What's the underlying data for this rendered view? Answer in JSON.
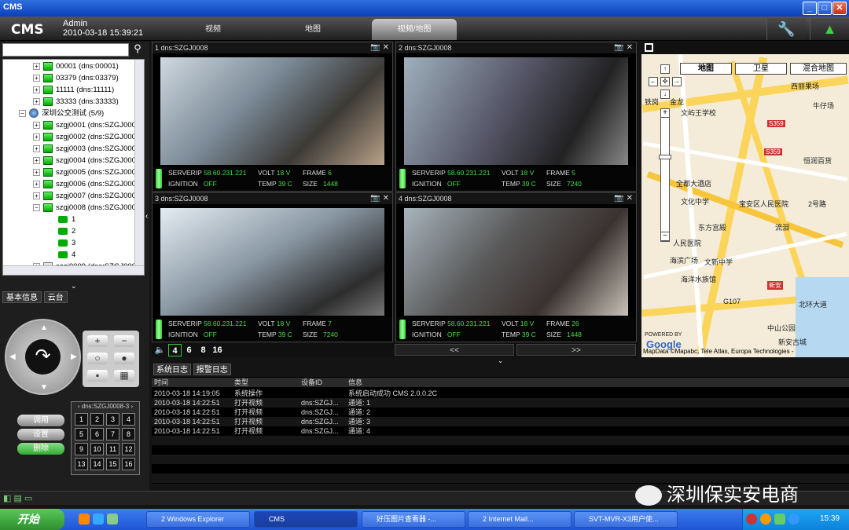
{
  "window": {
    "title": "CMS"
  },
  "header": {
    "logo": "CMS",
    "user": "Admin",
    "datetime": "2010-03-18 15:39:21",
    "tabs": [
      {
        "label": "视频"
      },
      {
        "label": "地图"
      },
      {
        "label": "视频/地图",
        "active": true
      }
    ]
  },
  "tree": {
    "items": [
      {
        "label": "00001 (dns:00001)",
        "level": 1,
        "type": "device"
      },
      {
        "label": "03379 (dns:03379)",
        "level": 1,
        "type": "device"
      },
      {
        "label": "11111 (dns:11111)",
        "level": 1,
        "type": "device"
      },
      {
        "label": "33333 (dns:33333)",
        "level": 1,
        "type": "device"
      },
      {
        "label": "深圳公交测试 (5/9)",
        "level": 0,
        "type": "group"
      },
      {
        "label": "szgj0001 (dns:SZGJ000",
        "level": 1,
        "type": "device"
      },
      {
        "label": "szgj0002 (dns:SZGJ000",
        "level": 1,
        "type": "device"
      },
      {
        "label": "szgj0003 (dns:SZGJ000",
        "level": 1,
        "type": "device"
      },
      {
        "label": "szgj0004 (dns:SZGJ000",
        "level": 1,
        "type": "device"
      },
      {
        "label": "szgj0005 (dns:SZGJ000",
        "level": 1,
        "type": "device"
      },
      {
        "label": "szgj0006 (dns:SZGJ000",
        "level": 1,
        "type": "device"
      },
      {
        "label": "szgj0007 (dns:SZGJ000",
        "level": 1,
        "type": "device"
      },
      {
        "label": "szgj0008 (dns:SZGJ000",
        "level": 1,
        "type": "device"
      },
      {
        "label": "1",
        "level": 2,
        "type": "camera"
      },
      {
        "label": "2",
        "level": 2,
        "type": "camera"
      },
      {
        "label": "3",
        "level": 2,
        "type": "camera"
      },
      {
        "label": "4",
        "level": 2,
        "type": "camera"
      },
      {
        "label": "szgj0009 (dns:SZGJ000",
        "level": 1,
        "type": "device-off"
      }
    ]
  },
  "leftTabs": [
    "基本信息",
    "云台"
  ],
  "ptz": {
    "presetHeader": "dns:SZGJ0008-3",
    "presets": [
      "1",
      "2",
      "3",
      "4",
      "5",
      "6",
      "7",
      "8",
      "9",
      "10",
      "11",
      "12",
      "13",
      "14",
      "15",
      "16"
    ],
    "buttons": [
      "调用",
      "设置",
      "删除"
    ]
  },
  "panes": [
    {
      "title": "1 dns:SZGJ0008",
      "serverip": "58.60.231.221",
      "volt": "18 V",
      "frame": "6",
      "ignition": "OFF",
      "temp": "39 C",
      "size": "1448"
    },
    {
      "title": "2 dns:SZGJ0008",
      "serverip": "58.60.231.221",
      "volt": "18 V",
      "frame": "5",
      "ignition": "OFF",
      "temp": "39 C",
      "size": "7240"
    },
    {
      "title": "3 dns:SZGJ0008",
      "serverip": "58.60.231.221",
      "volt": "18 V",
      "frame": "7",
      "ignition": "OFF",
      "temp": "39 C",
      "size": "7240"
    },
    {
      "title": "4 dns:SZGJ0008",
      "serverip": "58.60.231.221",
      "volt": "18 V",
      "frame": "26",
      "ignition": "OFF",
      "temp": "39 C",
      "size": "1448"
    }
  ],
  "statusLabels": {
    "serverip": "SERVERIP",
    "volt": "VOLT",
    "frame": "FRAME",
    "ignition": "IGNITION",
    "temp": "TEMP",
    "size": "SIZE"
  },
  "videoControls": {
    "layouts": [
      "4",
      "6",
      "8",
      "16"
    ],
    "prev": "<<",
    "next": ">>"
  },
  "map": {
    "types": [
      "地图",
      "卫星",
      "混合地图"
    ],
    "labels": [
      "西丽果场",
      "牛仔场",
      "铁岗",
      "金龙",
      "文屿王学校",
      "S359",
      "S359",
      "恒润百货",
      "全都大酒店",
      "文化中学",
      "宝安区人民医院",
      "2号路",
      "东方宫殿",
      "流泪",
      "人民医院",
      "海滨广场",
      "文新中学",
      "海洋水族馆",
      "北环大道",
      "新安",
      "G107",
      "中山公园",
      "新安古城",
      "POWERED BY",
      "Google"
    ],
    "attribution": "MapData ©Mapabc, Tele Atlas, Europa Technologies -"
  },
  "log": {
    "tabs": [
      "系统日志",
      "报警日志"
    ],
    "columns": [
      "时间",
      "类型",
      "设备ID",
      "信息"
    ],
    "rows": [
      [
        "2010-03-18 14:19:05",
        "系统操作",
        "",
        "系统启动成功 CMS 2.0.0.2C"
      ],
      [
        "2010-03-18 14:22:51",
        "打开视频",
        "dns:SZGJ...",
        "通道: 1"
      ],
      [
        "2010-03-18 14:22:51",
        "打开视频",
        "dns:SZGJ...",
        "通道: 2"
      ],
      [
        "2010-03-18 14:22:51",
        "打开视频",
        "dns:SZGJ...",
        "通道: 3"
      ],
      [
        "2010-03-18 14:22:51",
        "打开视频",
        "dns:SZGJ...",
        "通道: 4"
      ]
    ]
  },
  "watermark": "深圳保实安电商",
  "taskbar": {
    "start": "开始",
    "items": [
      "2 Windows Explorer",
      "CMS",
      "好压图片查看器 -...",
      "2 Internet Mail...",
      "SVT-MVR-X3用户使..."
    ],
    "clock": "15:39"
  }
}
